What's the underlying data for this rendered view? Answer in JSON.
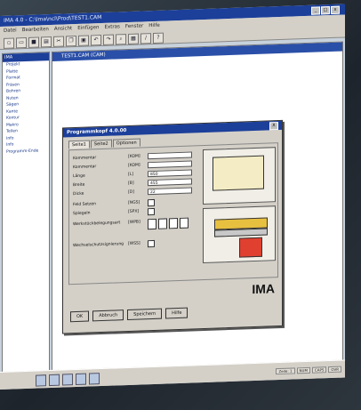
{
  "window": {
    "title": "IMA 4.0 - C:\\Ima\\ncl\\Prod\\TEST1.CAM"
  },
  "menu": [
    "Datei",
    "Bearbeiten",
    "Ansicht",
    "Einfügen",
    "Extras",
    "Fenster",
    "Hilfe"
  ],
  "toolbar_icons": [
    "new-icon",
    "open-icon",
    "save-icon",
    "print-icon",
    "cut-icon",
    "copy-icon",
    "paste-icon",
    "undo-icon",
    "redo-icon",
    "zoom-icon",
    "grid-icon",
    "tool-icon",
    "help-icon"
  ],
  "tree": {
    "header": "IMA",
    "items": [
      "Projekt",
      "Platte",
      "Format",
      "Fräsen",
      "Bohren",
      "Nuten",
      "Sägen",
      "Kante",
      "Kontur",
      "Makro",
      "Teilen",
      "Info",
      "Info",
      "Programm-Ende"
    ]
  },
  "document": {
    "title": "TEST1.CAM (CAM)"
  },
  "dialog": {
    "title": "Programmkopf 4.0.00",
    "close": "X",
    "tabs": [
      "Seite1",
      "Seite2",
      "Optionen"
    ],
    "fields": [
      {
        "label": "Kommentar",
        "unit": "[KOM]",
        "value": ""
      },
      {
        "label": "Kommentar",
        "unit": "[KOM]",
        "value": ""
      },
      {
        "label": "Länge",
        "unit": "[L]",
        "value": "850"
      },
      {
        "label": "Breite",
        "unit": "[B]",
        "value": "455"
      },
      {
        "label": "Dicke",
        "unit": "[D]",
        "value": "22"
      },
      {
        "label": "Feld Setzen",
        "unit": "[NGS]",
        "value": ""
      },
      {
        "label": "Spiegeln",
        "unit": "[SPX]",
        "value": ""
      },
      {
        "label": "Werkstückbelegungsart",
        "unit": "[WPB]",
        "value": ""
      },
      {
        "label": "Wechselschutzsignierung",
        "unit": "[WSS]",
        "value": ""
      }
    ],
    "logo": "IMA",
    "buttons": [
      "OK",
      "Abbruch",
      "Speichern",
      "Hilfe"
    ]
  },
  "statusbar": [
    "Zeile: 1",
    "NUM",
    "CAPS",
    "OVR"
  ]
}
